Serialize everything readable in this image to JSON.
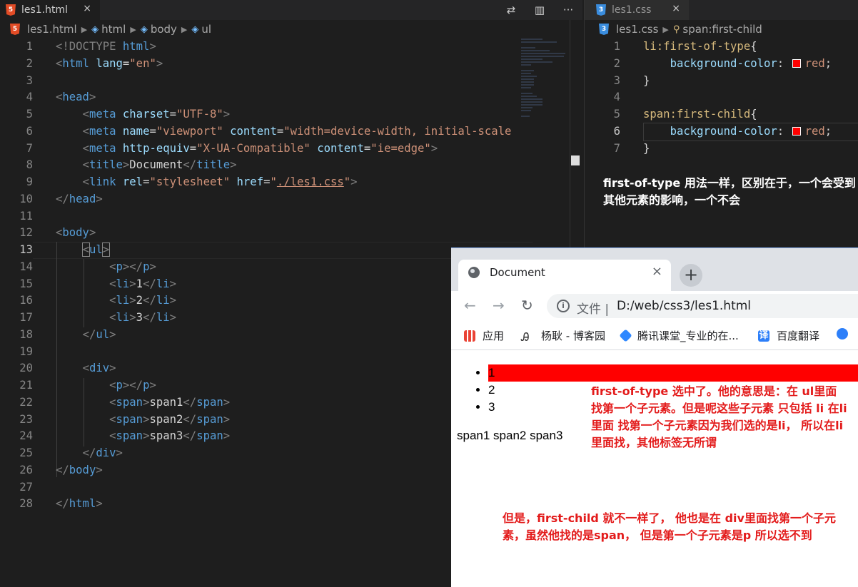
{
  "left_editor": {
    "tab": {
      "title": "les1.html",
      "icon": "html5-icon",
      "close": "×"
    },
    "breadcrumb": [
      "les1.html",
      "html",
      "body",
      "ul"
    ],
    "current_line": 13,
    "line_numbers": [
      1,
      2,
      3,
      4,
      5,
      6,
      7,
      8,
      9,
      10,
      11,
      12,
      13,
      14,
      15,
      16,
      17,
      18,
      19,
      20,
      21,
      22,
      23,
      24,
      25,
      26,
      27,
      28
    ],
    "code": {
      "l1_doctype": "<!DOCTYPE",
      "l1_html": "html",
      "l2_html": "html",
      "l2_lang": "lang",
      "l2_lang_val": "\"en\"",
      "l4_head": "head",
      "l5_meta": "meta",
      "l5_attr": "charset",
      "l5_val": "\"UTF-8\"",
      "l6_meta": "meta",
      "l6_attr1": "name",
      "l6_val1": "\"viewport\"",
      "l6_attr2": "content",
      "l6_val2": "\"width=device-width, initial-scale",
      "l7_meta": "meta",
      "l7_attr1": "http-equiv",
      "l7_val1": "\"X-UA-Compatible\"",
      "l7_attr2": "content",
      "l7_val2": "\"ie=edge\"",
      "l8_title": "title",
      "l8_text": "Document",
      "l9_link": "link",
      "l9_attr1": "rel",
      "l9_val1": "\"stylesheet\"",
      "l9_attr2": "href",
      "l9_val2_q": "\"",
      "l9_val2": "./les1.css",
      "l10_head": "head",
      "l12_body": "body",
      "l13_ul": "ul",
      "l14_p": "p",
      "l15_li": "li",
      "l15_text": "1",
      "l16_li": "li",
      "l16_text": "2",
      "l17_li": "li",
      "l17_text": "3",
      "l18_ul": "ul",
      "l20_div": "div",
      "l21_p": "p",
      "l22_span": "span",
      "l22_text": "span1",
      "l23_span": "span",
      "l23_text": "span2",
      "l24_span": "span",
      "l24_text": "span3",
      "l25_div": "div",
      "l26_body": "body",
      "l28_html": "html"
    }
  },
  "right_editor": {
    "tab": {
      "title": "les1.css",
      "icon": "css3-icon",
      "close": "×"
    },
    "breadcrumb": [
      "les1.css",
      "span:first-child"
    ],
    "current_line": 6,
    "line_numbers": [
      1,
      2,
      3,
      4,
      5,
      6,
      7
    ],
    "code": {
      "sel1": "li:first-of-type",
      "prop1": "background-color",
      "val1": "red",
      "sel2": "span:first-child",
      "prop2": "background-color",
      "val2": "red"
    },
    "swatch_color": "#ff0000",
    "note": "first-of-type 用法一样，区别在于，一个会受到其他元素的影响，一个不会"
  },
  "browser": {
    "tab_title": "Document",
    "tab_close": "×",
    "new_tab": "+",
    "address": {
      "label": "文件 |",
      "url": "D:/web/css3/les1.html"
    },
    "bookmarks": [
      {
        "label": "应用",
        "icon": "apps-grid-icon"
      },
      {
        "label": "杨耿 - 博客园",
        "icon": "blog-icon"
      },
      {
        "label": "腾讯课堂_专业的在...",
        "icon": "tencent-classroom-icon"
      },
      {
        "label": "百度翻译",
        "icon": "baidu-translate-icon"
      }
    ],
    "page": {
      "list_items": [
        "1",
        "2",
        "3"
      ],
      "spans": "span1 span2 span3",
      "highlight_color": "#ff0000"
    },
    "note_first_of_type": "first-of-type 选中了。他的意思是：在 ul里面找第一个子元素。但是呢这些子元素 只包括 li  在li里面 找第一个子元素因为我们选的是li， 所以在li里面找，其他标签无所谓",
    "note_first_child": "但是，first-child 就不一样了， 他也是在 div里面找第一个子元素，虽然他找的是span， 但是第一个子元素是p 所以选不到"
  }
}
